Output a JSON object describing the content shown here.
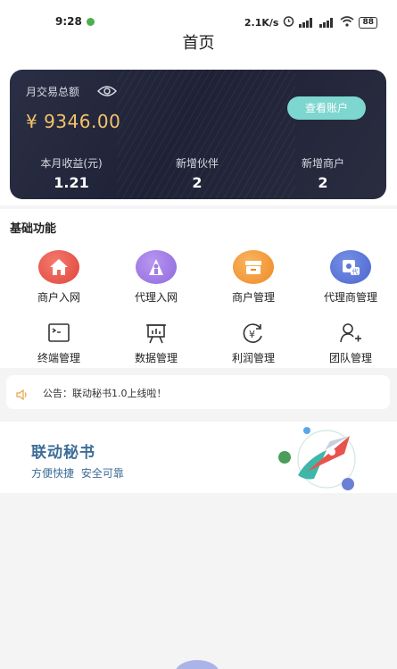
{
  "status_bar": {
    "time": "9:28",
    "speed": "2.1K/s",
    "battery": "88"
  },
  "header": {
    "title": "首页"
  },
  "account": {
    "monthly_label": "月交易总额",
    "amount": "¥ 9346.00",
    "view_button": "查看账户",
    "stats": [
      {
        "label": "本月收益(元)",
        "value": "1.21"
      },
      {
        "label": "新增伙伴",
        "value": "2"
      },
      {
        "label": "新增商户",
        "value": "2"
      }
    ]
  },
  "features": {
    "title": "基础功能",
    "items": [
      {
        "label": "商户入网",
        "icon": "home-icon",
        "color": "#e8544d"
      },
      {
        "label": "代理入网",
        "icon": "agent-icon",
        "color": "#a17de6"
      },
      {
        "label": "商户管理",
        "icon": "store-icon",
        "color": "#f39a3a"
      },
      {
        "label": "代理商管理",
        "icon": "agent-manage-icon",
        "color": "#5a78d8"
      },
      {
        "label": "终端管理",
        "icon": "terminal-icon"
      },
      {
        "label": "数据管理",
        "icon": "chart-board-icon"
      },
      {
        "label": "利润管理",
        "icon": "yen-refresh-icon"
      },
      {
        "label": "团队管理",
        "icon": "team-add-icon"
      }
    ]
  },
  "announcement": {
    "text": "公告：联动秘书1.0上线啦！"
  },
  "banner": {
    "title": "联动秘书",
    "subtitle": "方便快捷  安全可靠"
  }
}
